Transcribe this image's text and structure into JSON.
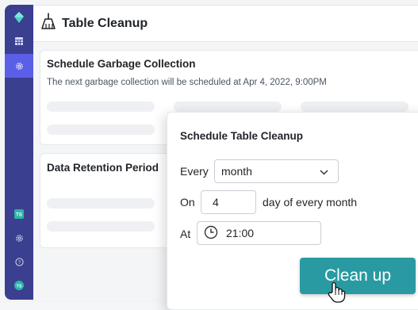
{
  "header": {
    "title": "Table Cleanup",
    "icon": "broom-icon"
  },
  "sidebar": {
    "items": [
      {
        "icon": "diamond-logo-icon"
      },
      {
        "icon": "grid-icon"
      },
      {
        "icon": "gear-icon",
        "active": true
      },
      {
        "icon": "ts-badge-icon",
        "label": "TS"
      },
      {
        "icon": "settings-icon"
      },
      {
        "icon": "help-icon",
        "label": "?"
      },
      {
        "icon": "user-avatar-icon",
        "label": "TS"
      }
    ]
  },
  "garbage": {
    "title": "Schedule Garbage Collection",
    "description": "The next garbage collection will be scheduled at Apr 4, 2022, 9:00PM"
  },
  "retention": {
    "title": "Data Retention Period"
  },
  "popup": {
    "title": "Schedule Table Cleanup",
    "every_label": "Every",
    "frequency_value": "month",
    "on_label": "On",
    "day_value": "4",
    "day_suffix": "day of every month",
    "at_label": "At",
    "time_value": "21:00",
    "button_label": "Clean up"
  },
  "colors": {
    "sidebar": "#3b3f8f",
    "accent": "#5b5fe8",
    "button": "#2a9aa2",
    "badge": "#2bb5a8"
  }
}
